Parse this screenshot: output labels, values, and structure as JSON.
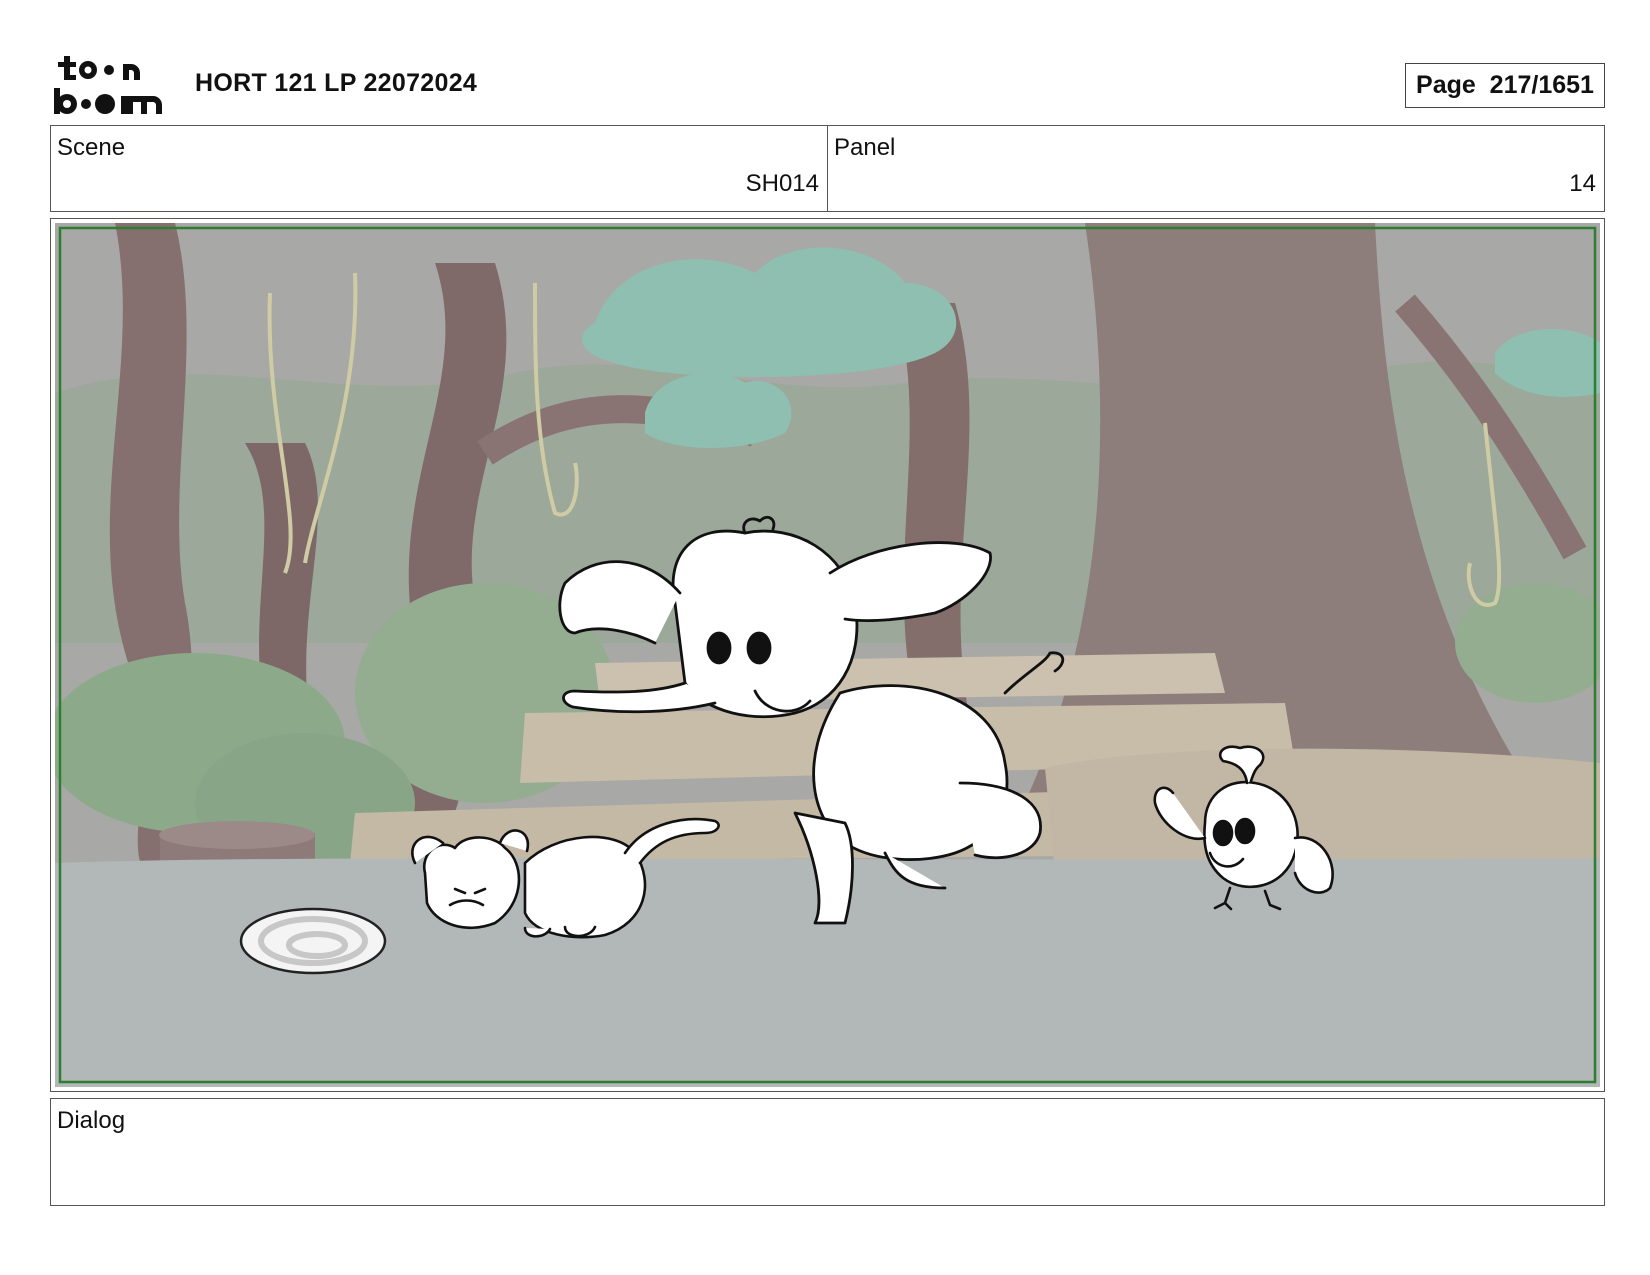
{
  "header": {
    "logo_text_top": "toon",
    "logo_text_bottom": "boom",
    "project_title": "HORT 121 LP 22072024",
    "page_indicator": "Page  217/1651"
  },
  "scene": {
    "label": "Scene",
    "value": "SH014"
  },
  "panel": {
    "label": "Panel",
    "value": "14"
  },
  "dialog": {
    "label": "Dialog",
    "text": ""
  },
  "colors": {
    "frame_green": "#2e7d32",
    "ground": "#b3b8ba",
    "background_wash": "#a9a9a9",
    "foliage": "#8fb08a",
    "tree_trunk": "#8e7a78"
  }
}
